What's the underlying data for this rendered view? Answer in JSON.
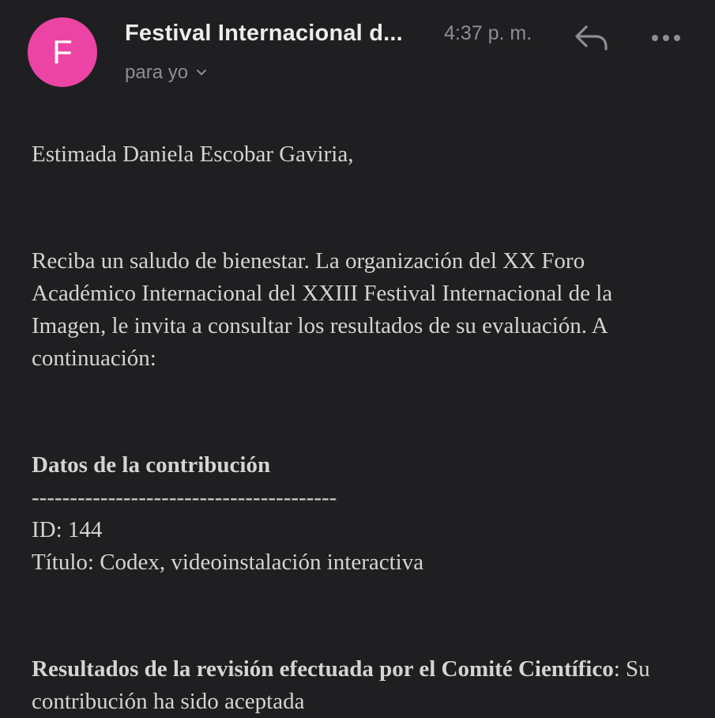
{
  "header": {
    "avatar_letter": "F",
    "avatar_color": "#ec44a4",
    "sender_name": "Festival Internacional d...",
    "time": "4:37 p. m.",
    "recipient": "para yo",
    "icons": {
      "reply": "reply-icon",
      "more": "more-icon",
      "chevron": "chevron-down-icon"
    }
  },
  "email": {
    "greeting": "Estimada Daniela Escobar Gaviria,",
    "intro": "Reciba un saludo de bienestar. La organización del XX Foro Académico Internacional del XXIII Festival Internacional de la Imagen, le invita a consultar los resultados de su evaluación. A continuación:",
    "contribution": {
      "heading": "Datos de la contribución",
      "separator": "----------------------------------------",
      "id_line": "ID: 144",
      "title_line": "Título: Codex, videoinstalación interactiva"
    },
    "results": {
      "label": "Resultados de la revisión efectuada por el Comité Científico",
      "value": ": Su contribución ha sido aceptada"
    }
  },
  "colors": {
    "background": "#1f1f21",
    "primary_text": "#ededed",
    "secondary_text": "#8d8d92",
    "body_text": "#d4d4d4"
  }
}
